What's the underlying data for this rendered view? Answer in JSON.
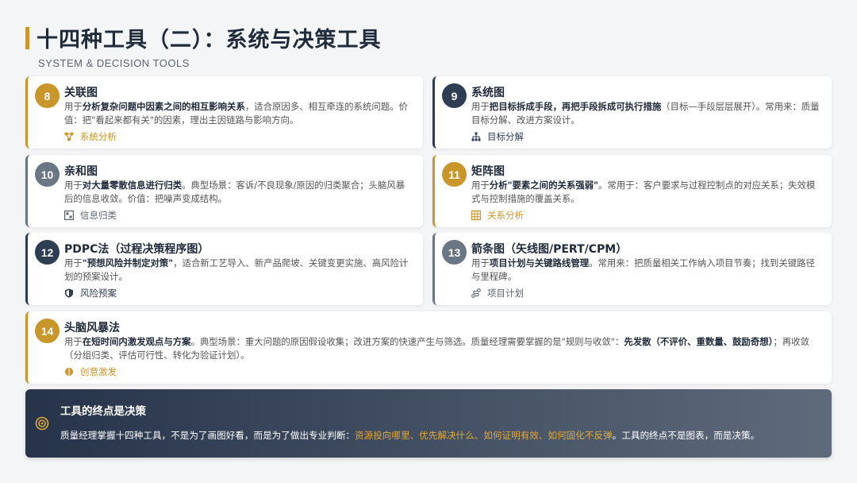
{
  "header": {
    "title": "十四种工具（二）：系统与决策工具",
    "subtitle": "SYSTEM & DECISION TOOLS"
  },
  "cards": [
    {
      "num": "8",
      "title": "关联图",
      "desc_pre": "用于",
      "desc_bold": "分析复杂问题中因素之间的相互影响关系",
      "desc_post": "，适合原因多、相互牵连的系统问题。价值：把\"看起来都有关\"的因素，理出主因链路与影响方向。",
      "tag": "系统分析",
      "icon": "network-icon"
    },
    {
      "num": "9",
      "title": "系统图",
      "desc_pre": "用于",
      "desc_bold": "把目标拆成手段，再把手段拆成可执行措施",
      "desc_post": "（目标—手段层层展开）。常用来：质量目标分解、改进方案设计。",
      "tag": "目标分解",
      "icon": "hierarchy-icon"
    },
    {
      "num": "10",
      "title": "亲和图",
      "desc_pre": "用于",
      "desc_bold": "对大量零散信息进行归类",
      "desc_post": "。典型场景：客诉/不良现象/原因的归类聚合；头脑风暴后的信息收敛。价值：把噪声变成结构。",
      "tag": "信息归类",
      "icon": "group-icon"
    },
    {
      "num": "11",
      "title": "矩阵图",
      "desc_pre": "用于",
      "desc_bold": "分析\"要素之间的关系强弱\"",
      "desc_post": "。常用于：客户要求与过程控制点的对应关系；失效模式与控制措施的覆盖关系。",
      "tag": "关系分析",
      "icon": "grid-icon"
    },
    {
      "num": "12",
      "title": "PDPC法（过程决策程序图）",
      "desc_pre": "用于",
      "desc_bold": "\"预想风险并制定对策\"",
      "desc_post": "，适合新工艺导入、新产品爬坡、关键变更实施、高风险计划的预案设计。",
      "tag": "风险预案",
      "icon": "shield-icon"
    },
    {
      "num": "13",
      "title": "箭条图（矢线图/PERT/CPM）",
      "desc_pre": "用于",
      "desc_bold": "项目计划与关键路线管理",
      "desc_post": "。常用来：把质量相关工作纳入项目节奏；找到关键路径与里程碑。",
      "tag": "项目计划",
      "icon": "route-icon"
    },
    {
      "num": "14",
      "title": "头脑风暴法",
      "desc_pre": "用于",
      "desc_bold": "在短时间内激发观点与方案",
      "desc_post": "。典型场景：重大问题的原因假设收集；改进方案的快速产生与筛选。质量经理需要掌握的是\"规则与收敛\"：",
      "desc_bold2": "先发散（不评价、重数量、鼓励奇想）",
      "desc_post2": "；再收敛（分组归类、评估可行性、转化为验证计划）。",
      "tag": "创意激发",
      "icon": "brain-icon"
    }
  ],
  "footer": {
    "title": "工具的终点是决策",
    "text_pre": "质量经理掌握十四种工具，不是为了画图好看，而是为了做出专业判断：",
    "text_hl": "资源投向哪里、优先解决什么、如何证明有效、如何固化不反弹",
    "text_post": "。工具的终点不是图表，而是决策。",
    "icon": "target-icon"
  },
  "colors": {
    "accent": "#c8962a",
    "dark": "#2e3d52",
    "gray": "#6b7684"
  }
}
